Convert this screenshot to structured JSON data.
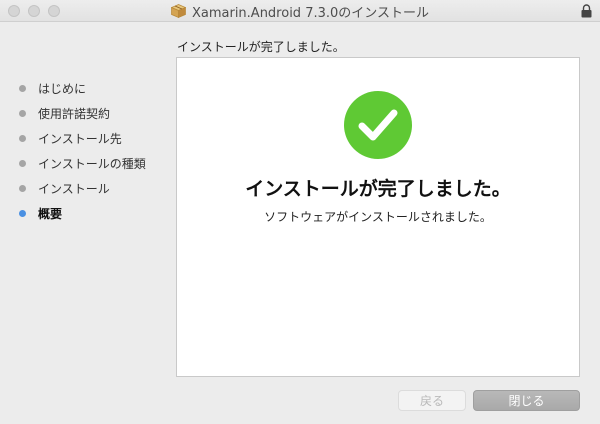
{
  "window": {
    "title": "Xamarin.Android 7.3.0のインストール"
  },
  "header": {
    "message": "インストールが完了しました。"
  },
  "sidebar": {
    "steps": [
      {
        "label": "はじめに",
        "active": false
      },
      {
        "label": "使用許諾契約",
        "active": false
      },
      {
        "label": "インストール先",
        "active": false
      },
      {
        "label": "インストールの種類",
        "active": false
      },
      {
        "label": "インストール",
        "active": false
      },
      {
        "label": "概要",
        "active": true
      }
    ]
  },
  "panel": {
    "icon": "checkmark-circle-icon",
    "title": "インストールが完了しました。",
    "subtitle": "ソフトウェアがインストールされました。"
  },
  "buttons": {
    "back_label": "戻る",
    "close_label": "閉じる"
  },
  "colors": {
    "success_green": "#5fc934",
    "active_step_blue": "#4a90e2",
    "inactive_step_gray": "#a5a5a5"
  }
}
